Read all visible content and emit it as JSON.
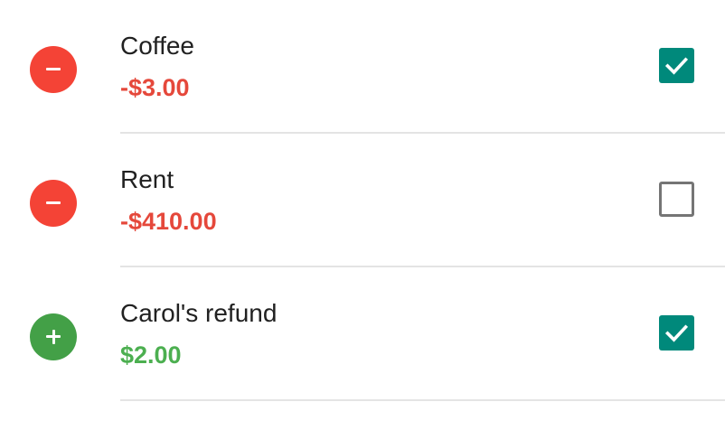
{
  "colors": {
    "expense": "#f44336",
    "expense_text": "#e5483b",
    "income": "#43a047",
    "income_text": "#4caf50",
    "checkbox_checked": "#00897b",
    "checkbox_unchecked_border": "#757575",
    "divider": "#e4e4e4"
  },
  "transactions": [
    {
      "name": "Coffee",
      "amount": "-$3.00",
      "type": "expense",
      "icon": "minus-icon",
      "checked": true
    },
    {
      "name": "Rent",
      "amount": "-$410.00",
      "type": "expense",
      "icon": "minus-icon",
      "checked": false
    },
    {
      "name": "Carol's refund",
      "amount": "$2.00",
      "type": "income",
      "icon": "plus-icon",
      "checked": true
    }
  ]
}
